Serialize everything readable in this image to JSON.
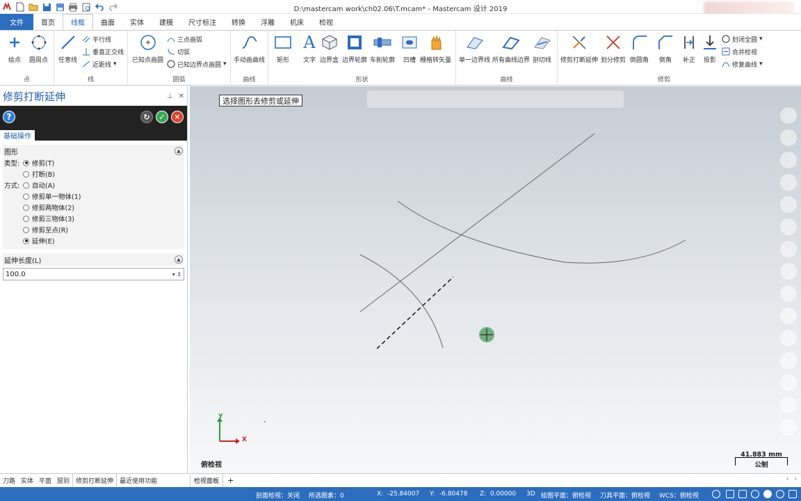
{
  "window": {
    "title": "D:\\mastercam work\\ch02.06\\T.mcam* - Mastercam 设计 2019"
  },
  "tabs": [
    {
      "label": "文件",
      "kind": "file"
    },
    {
      "label": "首页"
    },
    {
      "label": "线框",
      "active": true
    },
    {
      "label": "曲面"
    },
    {
      "label": "实体"
    },
    {
      "label": "建模"
    },
    {
      "label": "尺寸标注"
    },
    {
      "label": "转换"
    },
    {
      "label": "浮雕"
    },
    {
      "label": "机床"
    },
    {
      "label": "检视"
    }
  ],
  "ribbon": {
    "groups": {
      "point": "点",
      "line": "线",
      "arc": "圆弧",
      "curve": "曲线",
      "shape": "形状",
      "curve2": "曲线",
      "trim": "修剪"
    },
    "point": {
      "b1": "绘点",
      "b2": "圆周点"
    },
    "line": {
      "b1": "任意线",
      "s1": "平行线",
      "s2": "垂直正交线",
      "s3": "近距线"
    },
    "arc": {
      "b1": "已知点画圆",
      "s1": "三点画弧",
      "s2": "切弧",
      "s3": "已知边界点画圆"
    },
    "curve": {
      "b1": "手动画曲线"
    },
    "shape": {
      "b1": "矩形",
      "b2": "文字",
      "b3": "边界盒",
      "b4": "边界轮廓",
      "b5": "车削轮廓",
      "b6": "凹槽",
      "b7": "栅格转矢量"
    },
    "curve2": {
      "b1": "单一边界线",
      "b2": "所有曲线边界",
      "b3": "剖切线"
    },
    "trim": {
      "b1": "修剪打断延伸",
      "b2": "划分修剪",
      "b3": "倒圆角",
      "b4": "倒角",
      "b5": "补正",
      "b6": "投影",
      "s1": "封闭全圆",
      "s2": "合并检视",
      "s3": "修复曲线"
    }
  },
  "panel": {
    "title": "修剪打断延伸",
    "tab": "基础操作",
    "section_shape": "图形",
    "type_label": "类型:",
    "types": [
      {
        "label": "修剪(T)",
        "checked": true
      },
      {
        "label": "打断(B)",
        "checked": false
      }
    ],
    "method_label": "方式:",
    "methods": [
      {
        "label": "自动(A)",
        "checked": false
      },
      {
        "label": "修剪单一物体(1)",
        "checked": false
      },
      {
        "label": "修剪两物体(2)",
        "checked": false
      },
      {
        "label": "修剪三物体(3)",
        "checked": false
      },
      {
        "label": "修剪至点(R)",
        "checked": false
      },
      {
        "label": "延伸(E)",
        "checked": true
      }
    ],
    "section_length": "延伸长度(L)",
    "length_value": "100.0"
  },
  "panel_bottom_tabs": [
    {
      "label": "刀路"
    },
    {
      "label": "实体"
    },
    {
      "label": "平面"
    },
    {
      "label": "层别"
    },
    {
      "label": "修剪打断延伸",
      "active": true
    },
    {
      "label": "最近使用功能"
    }
  ],
  "view": {
    "prompt": "选择图形去修剪或延伸",
    "view_name": "俯检视",
    "axis_y": "Y",
    "axis_x": "X",
    "scale_value": "41.883 mm",
    "scale_unit": "公制",
    "sheet_tab": "检视面板",
    "sheet_add": "+"
  },
  "status": {
    "section_view": "剖面检视：关闭",
    "selected": "所选图素：0",
    "x_label": "X:",
    "x": "-25.84007",
    "y_label": "Y:",
    "y": "-6.80478",
    "z_label": "Z:",
    "z": "0.00000",
    "mode": "3D",
    "drawing_plane": "绘图平面：俯检视",
    "tool_plane": "刀具平面：俯检视",
    "wcs": "WCS：俯检视"
  },
  "colors": {
    "accent": "#2c6dbf",
    "panel_title": "#1f5fa8",
    "ok": "#3aa655",
    "cancel": "#d9452f"
  }
}
